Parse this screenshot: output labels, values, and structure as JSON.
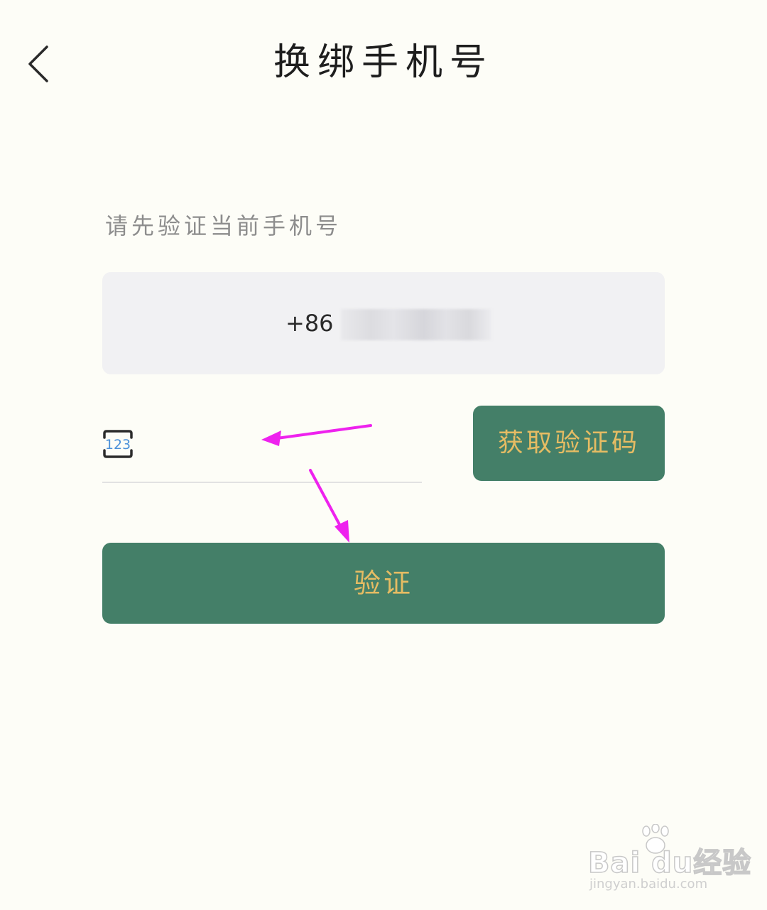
{
  "header": {
    "title": "换绑手机号",
    "back_icon": "chevron-left-icon"
  },
  "form": {
    "subtitle": "请先验证当前手机号",
    "phone": {
      "country_code": "+86",
      "number_masked": true
    },
    "code_input": {
      "icon": "numeric-keypad-icon",
      "icon_text": "123",
      "value": "",
      "placeholder": ""
    },
    "get_code_label": "获取验证码",
    "verify_label": "验证"
  },
  "annotations": {
    "arrow_color": "#ee22ee"
  },
  "watermark": {
    "logo_text": "Bai  du经验",
    "url": "jingyan.baidu.com"
  },
  "theme": {
    "background": "#fdfdf7",
    "primary": "#447f68",
    "button_text": "#e6bc63",
    "field_bg": "#f1f1f3"
  }
}
